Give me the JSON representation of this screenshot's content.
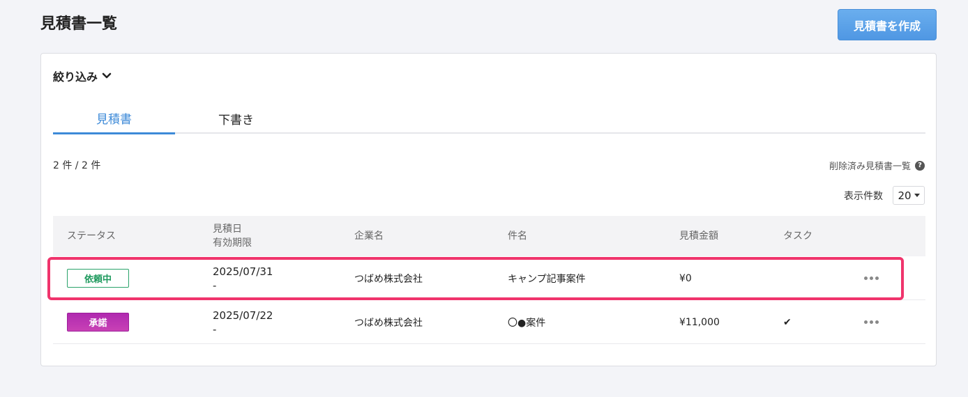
{
  "header": {
    "title": "見積書一覧",
    "create_button_label": "見積書を作成"
  },
  "filter": {
    "label": "絞り込み",
    "icon": "chevron-down-icon"
  },
  "tabs": [
    {
      "label": "見積書",
      "active": true
    },
    {
      "label": "下書き",
      "active": false
    }
  ],
  "result_count": "2 件 / 2 件",
  "deleted_link": {
    "label": "削除済み見積書一覧",
    "icon": "help-icon"
  },
  "per_page": {
    "label": "表示件数",
    "value": "20"
  },
  "table": {
    "headers": {
      "status": "ステータス",
      "date_line1": "見積日",
      "date_line2": "有効期限",
      "company": "企業名",
      "subject": "件名",
      "amount": "見積金額",
      "task": "タスク"
    },
    "rows": [
      {
        "status": "依頼中",
        "status_color": "#1f9a5e",
        "date": "2025/07/31",
        "expiry": "-",
        "company": "つばめ株式会社",
        "subject": "キャンプ記事案件",
        "amount": "¥0",
        "task_done": false,
        "highlighted": true
      },
      {
        "status": "承諾",
        "status_color": "#b02ab0",
        "date": "2025/07/22",
        "expiry": "-",
        "company": "つばめ株式会社",
        "subject": "〇●案件",
        "amount": "¥11,000",
        "task_done": true,
        "highlighted": false
      }
    ]
  },
  "colors": {
    "accent": "#3d8ad8",
    "highlight": "#f0346c"
  }
}
